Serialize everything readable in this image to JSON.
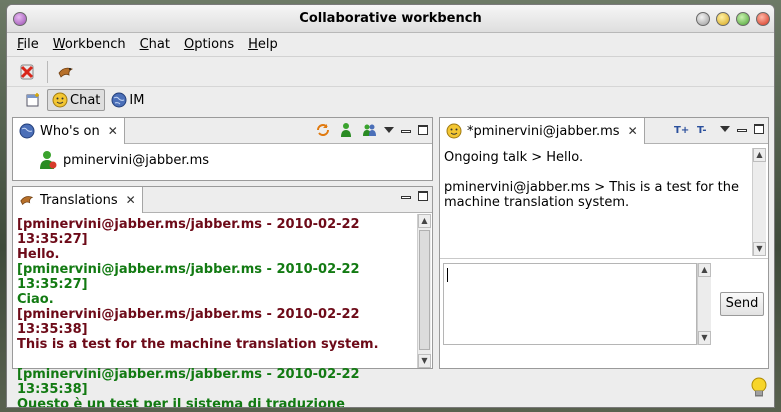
{
  "window": {
    "title": "Collaborative workbench"
  },
  "menu": [
    {
      "label": "File",
      "mnemonic": "F",
      "rest": "ile"
    },
    {
      "label": "Workbench",
      "mnemonic": "W",
      "rest": "orkbench"
    },
    {
      "label": "Chat",
      "mnemonic": "C",
      "rest": "hat"
    },
    {
      "label": "Options",
      "mnemonic": "O",
      "rest": "ptions"
    },
    {
      "label": "Help",
      "mnemonic": "H",
      "rest": "elp"
    }
  ],
  "perspectives": [
    {
      "label": "Chat",
      "icon": "chat-face-icon",
      "active": true
    },
    {
      "label": "IM",
      "icon": "globe-icon",
      "active": false
    }
  ],
  "whos_on": {
    "tab_label": "Who's on",
    "users": [
      "pminervini@jabber.ms"
    ]
  },
  "translations": {
    "tab_label": "Translations",
    "messages": [
      {
        "header": "[pminervini@jabber.ms/jabber.ms - 2010-02-22 13:35:27]",
        "body": "Hello.",
        "color": "#6d0a18"
      },
      {
        "header": "[pminervini@jabber.ms/jabber.ms - 2010-02-22 13:35:27]",
        "body": "Ciao.",
        "color": "#127a12"
      },
      {
        "header": "[pminervini@jabber.ms/jabber.ms - 2010-02-22 13:35:38]",
        "body": "This is a test for the machine translation system.",
        "color": "#6d0a18"
      },
      {
        "header": "[pminervini@jabber.ms/jabber.ms - 2010-02-22 13:35:38]",
        "body": "Questo è un test per il sistema di traduzione automatica.",
        "color": "#127a12"
      }
    ]
  },
  "chat": {
    "tab_label": "*pminervini@jabber.ms",
    "line1": "Ongoing talk > Hello.",
    "line2": "pminervini@jabber.ms > This is a test for the machine translation system.",
    "input_value": "",
    "send_label": "Send"
  },
  "colors": {
    "accent_red": "#6d0a18",
    "accent_green": "#127a12"
  }
}
